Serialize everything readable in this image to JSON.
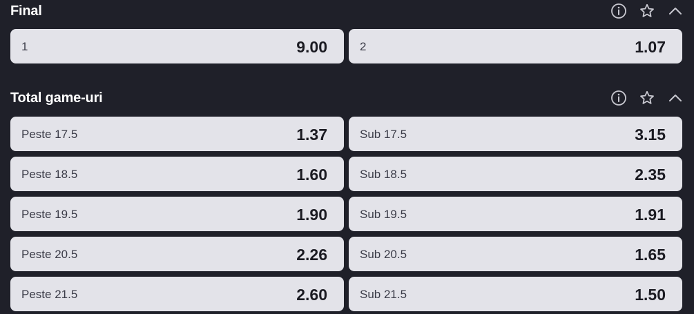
{
  "sections": [
    {
      "title": "Final",
      "odds": [
        {
          "label": "1",
          "value": "9.00"
        },
        {
          "label": "2",
          "value": "1.07"
        }
      ]
    },
    {
      "title": "Total game-uri",
      "odds": [
        {
          "label": "Peste 17.5",
          "value": "1.37"
        },
        {
          "label": "Sub 17.5",
          "value": "3.15"
        },
        {
          "label": "Peste 18.5",
          "value": "1.60"
        },
        {
          "label": "Sub 18.5",
          "value": "2.35"
        },
        {
          "label": "Peste 19.5",
          "value": "1.90"
        },
        {
          "label": "Sub 19.5",
          "value": "1.91"
        },
        {
          "label": "Peste 20.5",
          "value": "2.26"
        },
        {
          "label": "Sub 20.5",
          "value": "1.65"
        },
        {
          "label": "Peste 21.5",
          "value": "2.60"
        },
        {
          "label": "Sub 21.5",
          "value": "1.50"
        }
      ]
    }
  ],
  "header_icons": [
    "info-icon",
    "star-icon",
    "chevron-up-icon"
  ],
  "colors": {
    "background": "#1f2029",
    "button": "#e3e3e9",
    "label": "#3b3c48",
    "value": "#1b1b22",
    "icon": "#c8c8d0"
  }
}
